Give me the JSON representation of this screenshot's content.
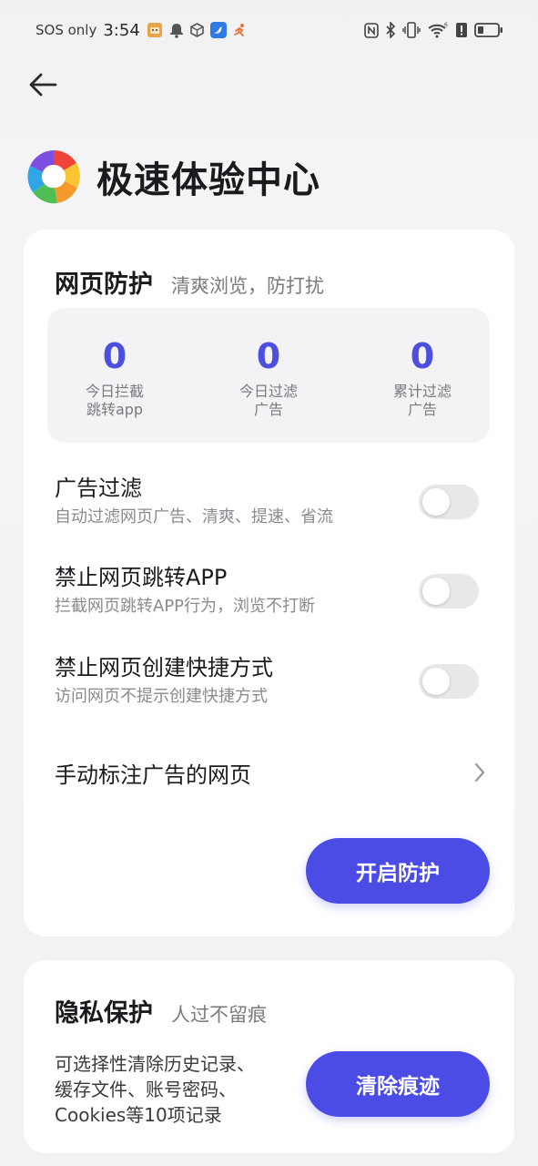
{
  "status_bar": {
    "carrier": "SOS only",
    "time": "3:54",
    "icons_left": [
      "app-avatar-icon",
      "bell-icon",
      "box-icon",
      "bird-app-icon",
      "runner-app-icon"
    ],
    "icons_right": [
      "nfc-icon",
      "bluetooth-icon",
      "vibrate-icon",
      "wifi-icon",
      "alert-icon",
      "battery-icon"
    ]
  },
  "header": {
    "back_icon": "arrow-left-icon",
    "title": "极速体验中心"
  },
  "web_protect": {
    "title": "网页防护",
    "subtitle": "清爽浏览，防打扰",
    "stats": [
      {
        "value": "0",
        "label_line1": "今日拦截",
        "label_line2": "跳转app"
      },
      {
        "value": "0",
        "label_line1": "今日过滤",
        "label_line2": "广告"
      },
      {
        "value": "0",
        "label_line1": "累计过滤",
        "label_line2": "广告"
      }
    ],
    "settings": [
      {
        "title": "广告过滤",
        "desc": "自动过滤网页广告、清爽、提速、省流",
        "enabled": false
      },
      {
        "title": "禁止网页跳转APP",
        "desc": "拦截网页跳转APP行为，浏览不打断",
        "enabled": false
      },
      {
        "title": "禁止网页创建快捷方式",
        "desc": "访问网页不提示创建快捷方式",
        "enabled": false
      }
    ],
    "manual_link": "手动标注广告的网页",
    "action_button": "开启防护"
  },
  "privacy": {
    "title": "隐私保护",
    "subtitle": "人过不留痕",
    "desc_line1": "可选择性清除历史记录、",
    "desc_line2": "缓存文件、账号密码、",
    "desc_line3": "Cookies等10项记录",
    "action_button": "清除痕迹"
  },
  "colors": {
    "accent": "#4b4ce6",
    "stat_value": "#4c4fe0",
    "card_bg": "#ffffff",
    "page_bg": "#f2f2f4"
  }
}
